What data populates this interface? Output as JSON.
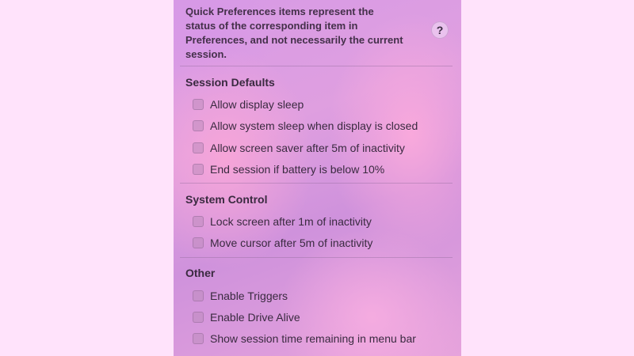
{
  "info": {
    "lines": [
      "Quick Preferences items represent the",
      "status of the corresponding item in",
      "Preferences, and not necessarily the current",
      "session."
    ],
    "help_label": "?",
    "help_icon": "question-mark-icon"
  },
  "sections": [
    {
      "title": "Session Defaults",
      "items": [
        {
          "label": "Allow display sleep",
          "checked": false
        },
        {
          "label": "Allow system sleep when display is closed",
          "checked": false
        },
        {
          "label": "Allow screen saver after 5m of inactivity",
          "checked": false
        },
        {
          "label": "End session if battery is below 10%",
          "checked": false
        }
      ]
    },
    {
      "title": "System Control",
      "items": [
        {
          "label": "Lock screen after 1m of inactivity",
          "checked": false
        },
        {
          "label": "Move cursor after 5m of inactivity",
          "checked": false
        }
      ]
    },
    {
      "title": "Other",
      "items": [
        {
          "label": "Enable Triggers",
          "checked": false
        },
        {
          "label": "Enable Drive Alive",
          "checked": false
        },
        {
          "label": "Show session time remaining in menu bar",
          "checked": false
        }
      ]
    }
  ]
}
